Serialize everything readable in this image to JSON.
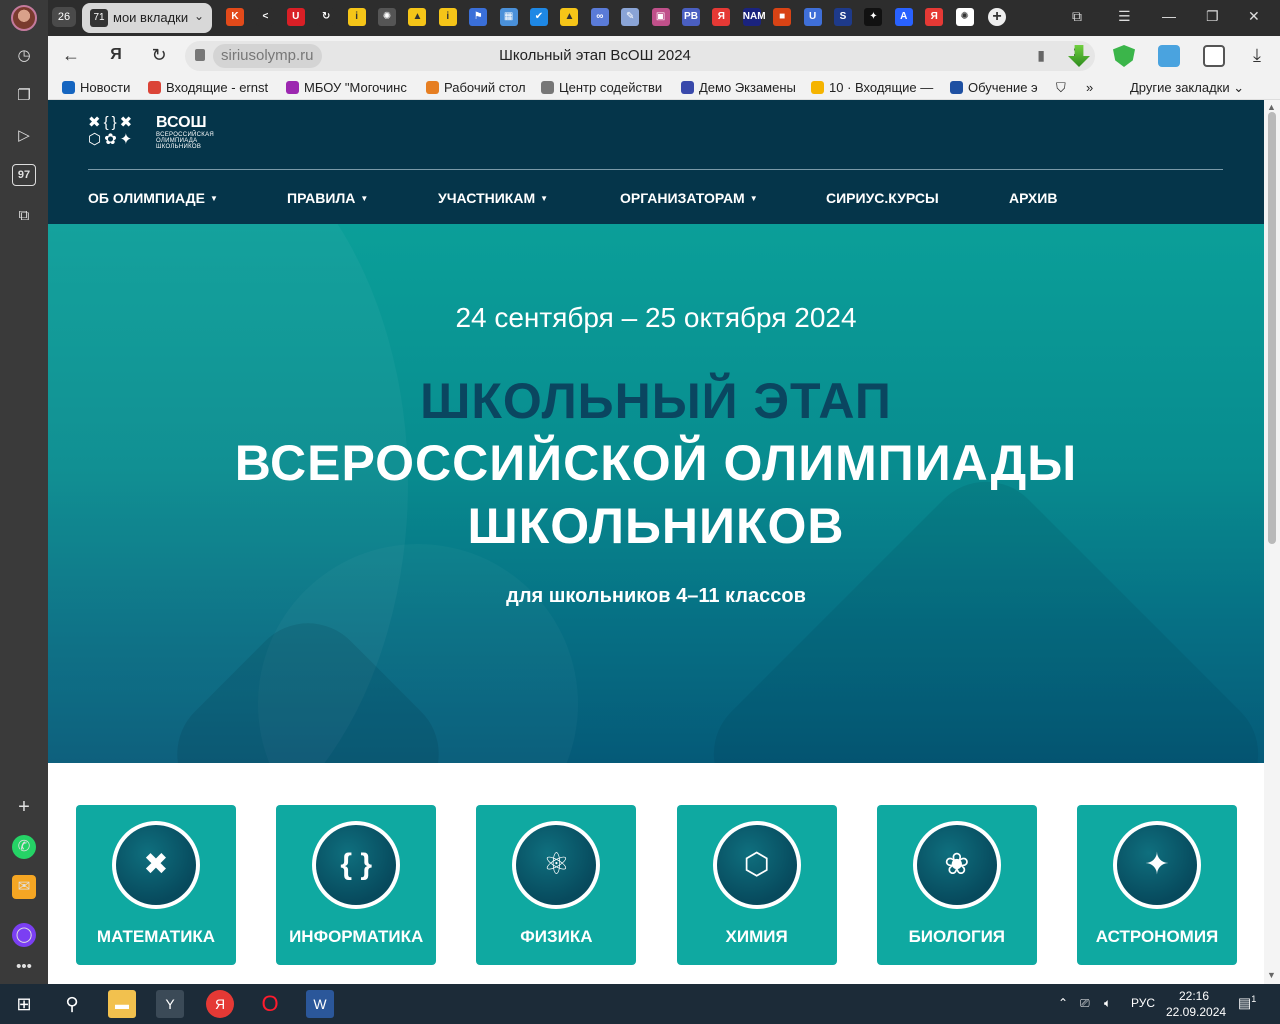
{
  "browser": {
    "tab_count": "26",
    "my_tabs": {
      "count": "71",
      "label": "мои вкладки"
    },
    "url_host": "siriusolymp.ru",
    "page_title": "Школьный этап ВсОШ 2024",
    "sidebar_badge": "97",
    "tab_icons": [
      {
        "name": "k-icon",
        "color": "#e24a1a",
        "glyph": "K"
      },
      {
        "name": "back-tab-icon",
        "color": "#2d2d2d",
        "glyph": "<"
      },
      {
        "name": "u-icon",
        "color": "#d91f26",
        "glyph": "U"
      },
      {
        "name": "refresh-tab-icon",
        "color": "#2d2d2d",
        "glyph": "↻"
      },
      {
        "name": "info-icon",
        "color": "#f5c518",
        "glyph": "i"
      },
      {
        "name": "dots-icon",
        "color": "#555",
        "glyph": "✺"
      },
      {
        "name": "image-icon",
        "color": "#f5c518",
        "glyph": "▲"
      },
      {
        "name": "info2-icon",
        "color": "#f5c518",
        "glyph": "i"
      },
      {
        "name": "flag-icon",
        "color": "#3a6fd8",
        "glyph": "⚑"
      },
      {
        "name": "grid-icon",
        "color": "#4a90d9",
        "glyph": "▦"
      },
      {
        "name": "check-icon",
        "color": "#1e88e5",
        "glyph": "✔"
      },
      {
        "name": "image2-icon",
        "color": "#f5c518",
        "glyph": "▲"
      },
      {
        "name": "infinity-icon",
        "color": "#5a7bd8",
        "glyph": "∞"
      },
      {
        "name": "draw-icon",
        "color": "#8aa4d6",
        "glyph": "✎"
      },
      {
        "name": "photo-icon",
        "color": "#c0508a",
        "glyph": "▣"
      },
      {
        "name": "pb-icon",
        "color": "#4a5fc1",
        "glyph": "PB"
      },
      {
        "name": "yandex-tab-icon",
        "color": "#e53935",
        "glyph": "Я"
      },
      {
        "name": "nam-icon",
        "color": "#1a237e",
        "glyph": "NAM"
      },
      {
        "name": "box-icon",
        "color": "#d84315",
        "glyph": "■"
      },
      {
        "name": "u2-icon",
        "color": "#3f6fd8",
        "glyph": "U"
      },
      {
        "name": "s-icon",
        "color": "#1e3a8a",
        "glyph": "S"
      },
      {
        "name": "spark-icon",
        "color": "#111",
        "glyph": "✦"
      },
      {
        "name": "a-icon",
        "color": "#2962ff",
        "glyph": "A"
      },
      {
        "name": "yandex2-tab-icon",
        "color": "#e53935",
        "glyph": "Я"
      },
      {
        "name": "active-tab-icon",
        "color": "#ffffff",
        "glyph": "✺"
      }
    ],
    "bookmarks": [
      {
        "label": "Новости",
        "color": "#1565c0"
      },
      {
        "label": "Входящие - ernst",
        "color": "#db4437"
      },
      {
        "label": "МБОУ \"Могочинс",
        "color": "#9c27b0"
      },
      {
        "label": "Рабочий стол",
        "color": "#e67e22"
      },
      {
        "label": "Центр содействи",
        "color": "#777"
      },
      {
        "label": "Демо Экзамены",
        "color": "#3949ab"
      },
      {
        "label": "10 · Входящие — ",
        "color": "#f5b400"
      },
      {
        "label": "Обучение э",
        "color": "#1e50a2"
      }
    ],
    "other_bookmarks": "Другие закладки"
  },
  "site": {
    "logo_brand": "ВСОШ",
    "logo_sub": "ВСЕРОССИЙСКАЯ ОЛИМПИАДА ШКОЛЬНИКОВ",
    "nav": [
      {
        "label": "ОБ ОЛИМПИАДЕ",
        "caret": "▼"
      },
      {
        "label": "ПРАВИЛА",
        "caret": "▼"
      },
      {
        "label": "УЧАСТНИКАМ",
        "caret": "▼"
      },
      {
        "label": "ОРГАНИЗАТОРАМ",
        "caret": "▼"
      },
      {
        "label": "СИРИУС.КУРСЫ",
        "caret": ""
      },
      {
        "label": "АРХИВ",
        "caret": ""
      }
    ],
    "hero": {
      "dates": "24 сентября – 25 октября 2024",
      "title_line1": "ШКОЛЬНЫЙ ЭТАП",
      "title_line2": "ВСЕРОССИЙСКОЙ ОЛИМПИАДЫ",
      "title_line3": "ШКОЛЬНИКОВ",
      "audience": "для школьников 4–11 классов"
    },
    "subjects": [
      {
        "label": "МАТЕМАТИКА",
        "icon": "math-icon",
        "glyph": "✖"
      },
      {
        "label": "ИНФОРМАТИКА",
        "icon": "informatics-icon",
        "glyph": "{ }"
      },
      {
        "label": "ФИЗИКА",
        "icon": "physics-icon",
        "glyph": "⚛"
      },
      {
        "label": "ХИМИЯ",
        "icon": "chemistry-icon",
        "glyph": "⬡"
      },
      {
        "label": "БИОЛОГИЯ",
        "icon": "biology-icon",
        "glyph": "❀"
      },
      {
        "label": "АСТРОНОМИЯ",
        "icon": "astronomy-icon",
        "glyph": "✦"
      }
    ]
  },
  "taskbar": {
    "language": "РУС",
    "time": "22:16",
    "date": "22.09.2024",
    "notifications": "1"
  }
}
